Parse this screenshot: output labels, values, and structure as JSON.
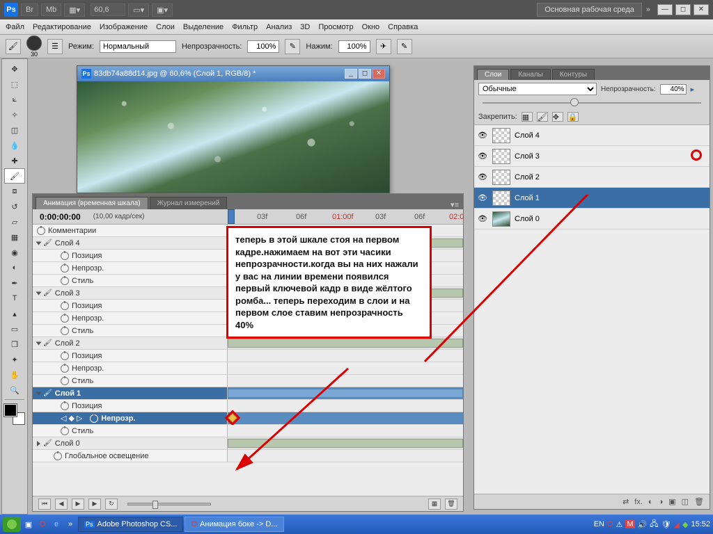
{
  "topbar": {
    "zoom": "60,6",
    "workspace_label": "Основная рабочая среда"
  },
  "menu": [
    "Файл",
    "Редактирование",
    "Изображение",
    "Слои",
    "Выделение",
    "Фильтр",
    "Анализ",
    "3D",
    "Просмотр",
    "Окно",
    "Справка"
  ],
  "optbar": {
    "brush_size": "30",
    "mode_label": "Режим:",
    "mode_value": "Нормальный",
    "opacity_label": "Непрозрачность:",
    "opacity_value": "100%",
    "flow_label": "Нажим:",
    "flow_value": "100%"
  },
  "doc": {
    "title": "83db74a88d14.jpg @ 60,6% (Слой 1, RGB/8) *"
  },
  "anim": {
    "tab_timeline": "Анимация (временная шкала)",
    "tab_log": "Журнал измерений",
    "timecode": "0:00:00:00",
    "fps": "(10,00 кадр/сек)",
    "ticks": [
      "03f",
      "06f",
      "01:00f",
      "03f",
      "06f",
      "02:0"
    ],
    "comments": "Комментарии",
    "layers": [
      {
        "name": "Слой 4",
        "props": [
          "Позиция",
          "Непрозр.",
          "Стиль"
        ]
      },
      {
        "name": "Слой 3",
        "props": [
          "Позиция",
          "Непрозр.",
          "Стиль"
        ]
      },
      {
        "name": "Слой 2",
        "props": [
          "Позиция",
          "Непрозр.",
          "Стиль"
        ]
      },
      {
        "name": "Слой 1",
        "props": [
          "Позиция",
          "Непрозр.",
          "Стиль"
        ],
        "selected_prop": 1
      },
      {
        "name": "Слой 0"
      }
    ],
    "global": "Глобальное освещение"
  },
  "layers": {
    "tab_layers": "Слои",
    "tab_channels": "Каналы",
    "tab_paths": "Контуры",
    "blend": "Обычные",
    "opacity_label": "Непрозрачность:",
    "opacity_value": "40%",
    "lock_label": "Закрепить:",
    "items": [
      {
        "name": "Слой 4"
      },
      {
        "name": "Слой 3"
      },
      {
        "name": "Слой 2"
      },
      {
        "name": "Слой 1",
        "selected": true
      },
      {
        "name": "Слой 0",
        "img": true
      }
    ]
  },
  "callout": "теперь в этой шкале стоя на первом кадре.нажимаем на вот эти часики непрозрачности.когда вы на них нажали у вас на линии времени появился первый ключевой кадр в виде жёлтого ромба... теперь переходим в слои и на первом слое ставим непрозрачность  40%",
  "taskbar": {
    "task1": "Adobe Photoshop CS...",
    "task2": "Анимация боке -> D...",
    "lang": "EN",
    "time": "15:52"
  }
}
